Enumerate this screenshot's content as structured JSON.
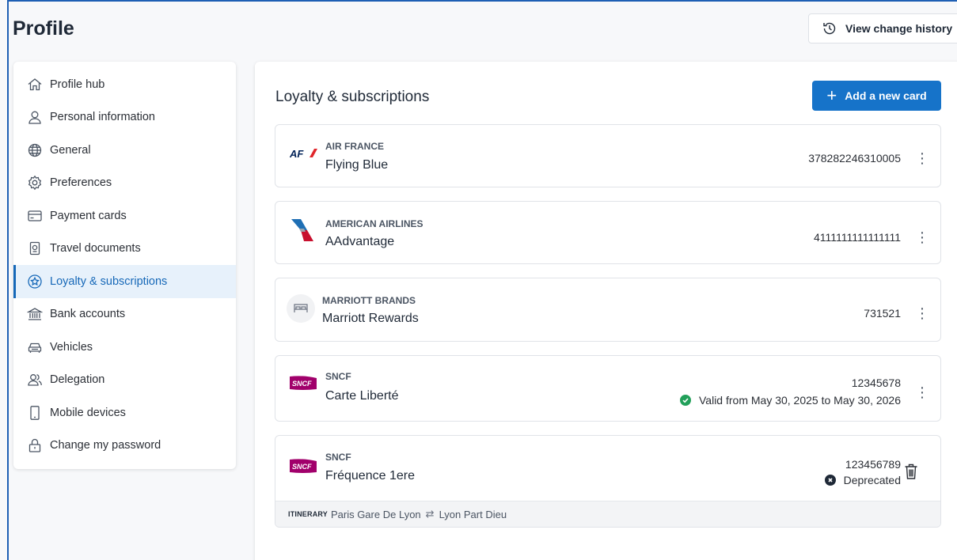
{
  "page": {
    "title": "Profile"
  },
  "header": {
    "history_label": "View change history"
  },
  "sidebar": {
    "items": [
      {
        "label": "Profile hub",
        "icon": "home-icon"
      },
      {
        "label": "Personal information",
        "icon": "user-icon"
      },
      {
        "label": "General",
        "icon": "globe-icon"
      },
      {
        "label": "Preferences",
        "icon": "gear-icon"
      },
      {
        "label": "Payment cards",
        "icon": "credit-card-icon"
      },
      {
        "label": "Travel documents",
        "icon": "passport-icon"
      },
      {
        "label": "Loyalty & subscriptions",
        "icon": "star-badge-icon",
        "active": true
      },
      {
        "label": "Bank accounts",
        "icon": "bank-icon"
      },
      {
        "label": "Vehicles",
        "icon": "car-icon"
      },
      {
        "label": "Delegation",
        "icon": "users-icon"
      },
      {
        "label": "Mobile devices",
        "icon": "phone-icon"
      },
      {
        "label": "Change my password",
        "icon": "lock-icon"
      }
    ]
  },
  "main": {
    "title": "Loyalty & subscriptions",
    "add_label": "Add a new card",
    "cards": [
      {
        "brand": "AIR FRANCE",
        "program": "Flying Blue",
        "number": "378282246310005",
        "logo_text": "AF"
      },
      {
        "brand": "AMERICAN AIRLINES",
        "program": "AAdvantage",
        "number": "4111111111111111"
      },
      {
        "brand": "MARRIOTT BRANDS",
        "program": "Marriott Rewards",
        "number": "731521"
      },
      {
        "brand": "SNCF",
        "program": "Carte Liberté",
        "number": "12345678",
        "status": "Valid from May 30, 2025 to May 30, 2026",
        "logo_text": "SNCF"
      },
      {
        "brand": "SNCF",
        "program": "Fréquence 1ere",
        "number": "123456789",
        "status": "Deprecated",
        "logo_text": "SNCF",
        "itinerary": {
          "label": "ITINERARY",
          "from": "Paris Gare De Lyon",
          "to": "Lyon Part Dieu"
        }
      }
    ]
  },
  "colors": {
    "accent": "#1673c9",
    "active_bg": "#e7f1fb",
    "valid": "#22a05a",
    "deprecated": "#1f2937",
    "af_red": "#e0262b",
    "af_blue": "#002157",
    "sncf": "#a1006b"
  }
}
